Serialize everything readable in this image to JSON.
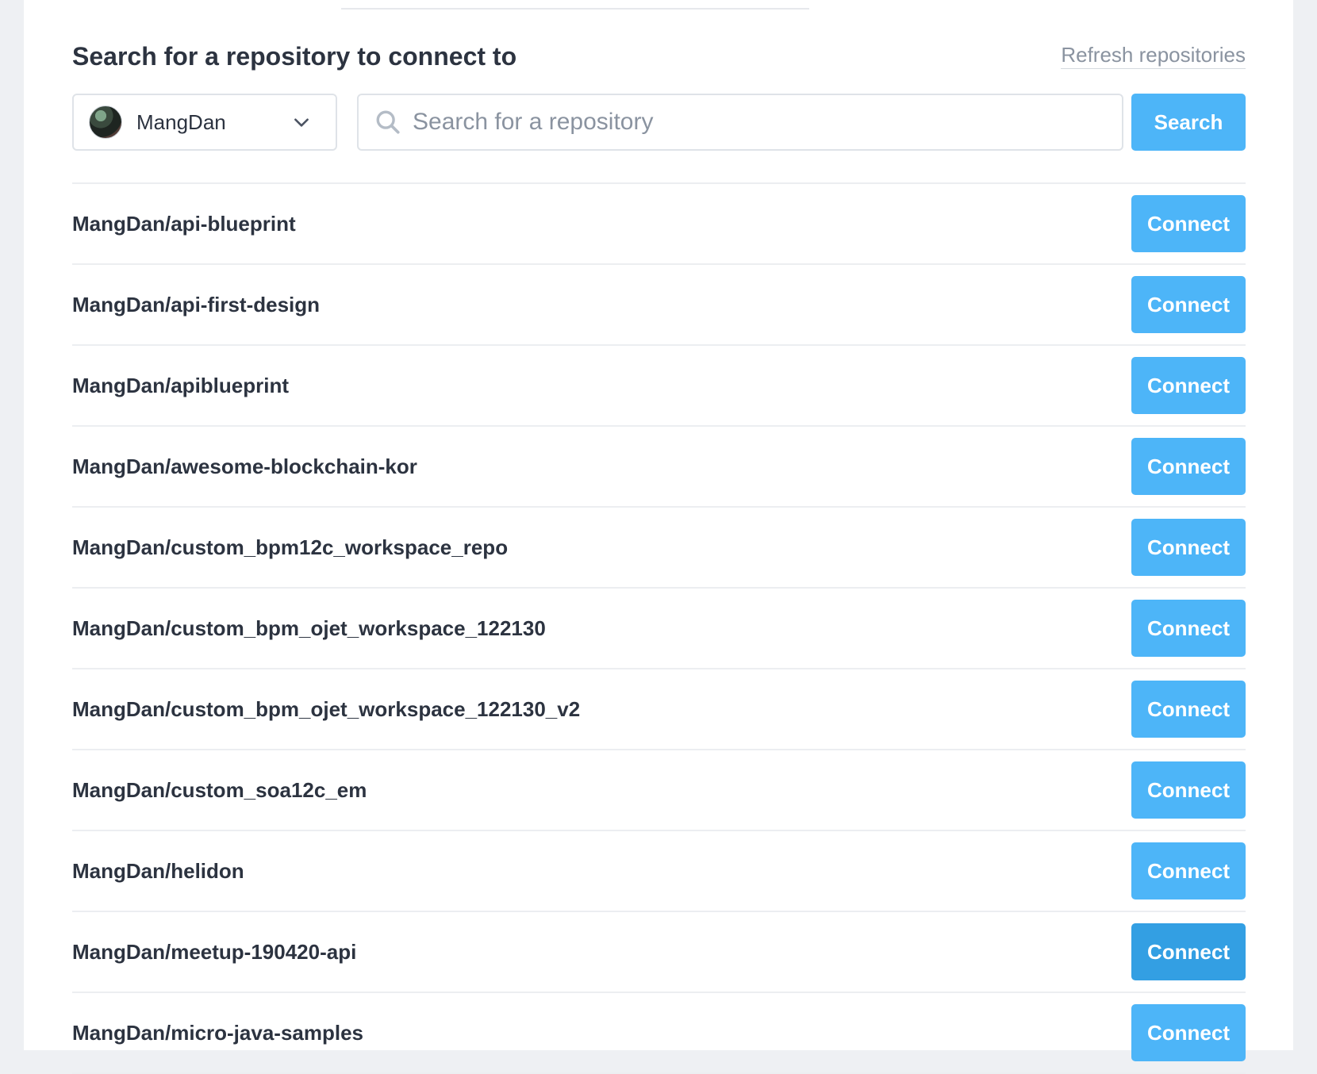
{
  "header": {
    "title": "Search for a repository to connect to",
    "refresh_label": "Refresh repositories"
  },
  "owner_select": {
    "selected": "MangDan",
    "avatar_icon": "user-avatar",
    "dropdown_icon": "chevron-down-icon"
  },
  "search": {
    "placeholder": "Search for a repository",
    "value": "",
    "button_label": "Search",
    "icon": "search-icon"
  },
  "colors": {
    "accent": "#4db5f8",
    "accent_hover": "#339fe3",
    "text": "#2c3340",
    "muted": "#8a93a0",
    "border": "#dfe3e8"
  },
  "repositories": [
    {
      "name": "MangDan/api-blueprint",
      "button_label": "Connect"
    },
    {
      "name": "MangDan/api-first-design",
      "button_label": "Connect"
    },
    {
      "name": "MangDan/apiblueprint",
      "button_label": "Connect"
    },
    {
      "name": "MangDan/awesome-blockchain-kor",
      "button_label": "Connect"
    },
    {
      "name": "MangDan/custom_bpm12c_workspace_repo",
      "button_label": "Connect"
    },
    {
      "name": "MangDan/custom_bpm_ojet_workspace_122130",
      "button_label": "Connect"
    },
    {
      "name": "MangDan/custom_bpm_ojet_workspace_122130_v2",
      "button_label": "Connect"
    },
    {
      "name": "MangDan/custom_soa12c_em",
      "button_label": "Connect"
    },
    {
      "name": "MangDan/helidon",
      "button_label": "Connect"
    },
    {
      "name": "MangDan/meetup-190420-api",
      "button_label": "Connect",
      "hovered": true
    },
    {
      "name": "MangDan/micro-java-samples",
      "button_label": "Connect"
    }
  ]
}
